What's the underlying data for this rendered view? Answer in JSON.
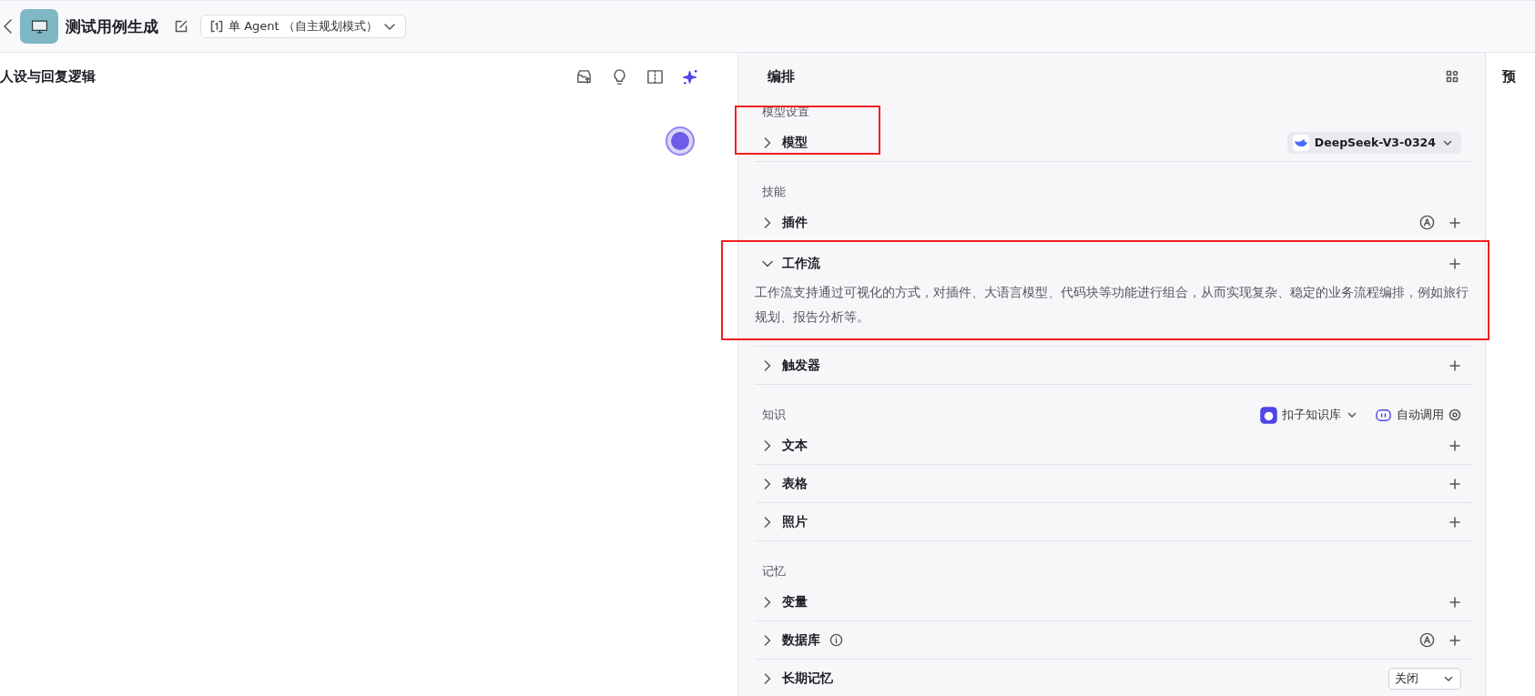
{
  "top_bar": {
    "title": "测试用例生成",
    "mode": {
      "text": "单 Agent （自主规划模式）"
    }
  },
  "persona_panel": {
    "title": "人设与回复逻辑"
  },
  "orchestration": {
    "title": "编排",
    "groups": [
      {
        "label": "模型设置",
        "items": [
          {
            "label": "模型",
            "expanded": false,
            "highlighted": true,
            "trailing": [
              {
                "kind": "model",
                "text": "DeepSeek-V3-0324"
              }
            ]
          }
        ]
      },
      {
        "label": "技能",
        "items": [
          {
            "label": "插件",
            "expanded": false,
            "trailing": [
              {
                "kind": "auto"
              },
              {
                "kind": "add"
              }
            ]
          },
          {
            "label": "工作流",
            "expanded": true,
            "highlighted": true,
            "description": "工作流支持通过可视化的方式，对插件、大语言模型、代码块等功能进行组合，从而实现复杂、稳定的业务流程编排，例如旅行规划、报告分析等。",
            "trailing": [
              {
                "kind": "add"
              }
            ]
          },
          {
            "label": "触发器",
            "expanded": false,
            "trailing": [
              {
                "kind": "add"
              }
            ]
          }
        ]
      },
      {
        "label": "知识",
        "extras": [
          {
            "kind": "source",
            "text": "扣子知识库"
          },
          {
            "kind": "mode",
            "text": "自动调用"
          }
        ],
        "items": [
          {
            "label": "文本",
            "expanded": false,
            "trailing": [
              {
                "kind": "add"
              }
            ]
          },
          {
            "label": "表格",
            "expanded": false,
            "trailing": [
              {
                "kind": "add"
              }
            ]
          },
          {
            "label": "照片",
            "expanded": false,
            "trailing": [
              {
                "kind": "add"
              }
            ]
          }
        ]
      },
      {
        "label": "记忆",
        "items": [
          {
            "label": "变量",
            "expanded": false,
            "trailing": [
              {
                "kind": "add"
              }
            ]
          },
          {
            "label": "数据库",
            "expanded": false,
            "info": true,
            "trailing": [
              {
                "kind": "auto"
              },
              {
                "kind": "add"
              }
            ]
          },
          {
            "label": "长期记忆",
            "expanded": false,
            "trailing": [
              {
                "kind": "select",
                "text": "关闭"
              }
            ]
          }
        ]
      }
    ]
  },
  "preview_panel": {
    "title": "预"
  }
}
